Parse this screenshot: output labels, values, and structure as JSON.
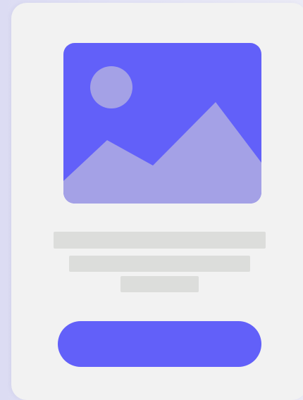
{
  "colors": {
    "background": "#e2e2f5",
    "card": "#f2f2f2",
    "accent": "#6260f9",
    "image_shape": "#a4a1e6",
    "placeholder_line": "#dcdddb"
  },
  "illustration": {
    "icon": "image-placeholder-icon"
  },
  "text_placeholders": {
    "line_count": 3
  },
  "cta_button": {
    "label": ""
  }
}
